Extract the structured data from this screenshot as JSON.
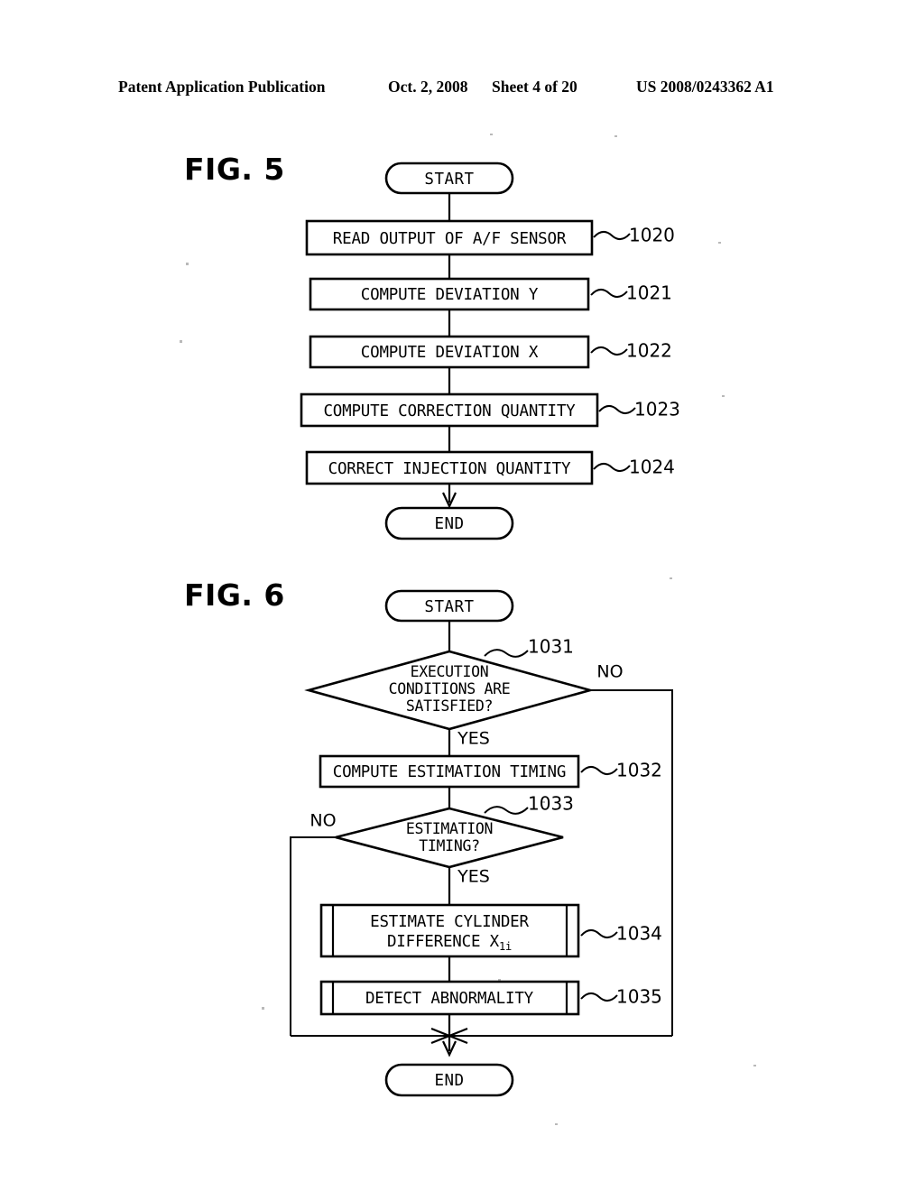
{
  "header": {
    "publication": "Patent Application Publication",
    "date": "Oct. 2, 2008",
    "sheet": "Sheet 4 of 20",
    "patent_number": "US 2008/0243362 A1"
  },
  "figures": [
    {
      "id": "fig5",
      "label": "FIG. 5",
      "terminators": {
        "start": "START",
        "end": "END"
      },
      "steps": [
        {
          "ref": "1020",
          "text": "READ OUTPUT OF A/F SENSOR"
        },
        {
          "ref": "1021",
          "text": "COMPUTE DEVIATION Y"
        },
        {
          "ref": "1022",
          "text": "COMPUTE DEVIATION X"
        },
        {
          "ref": "1023",
          "text": "COMPUTE CORRECTION QUANTITY"
        },
        {
          "ref": "1024",
          "text": "CORRECT INJECTION QUANTITY"
        }
      ]
    },
    {
      "id": "fig6",
      "label": "FIG. 6",
      "terminators": {
        "start": "START",
        "end": "END"
      },
      "decisions": [
        {
          "ref": "1031",
          "lines": [
            "EXECUTION",
            "CONDITIONS ARE",
            "SATISFIED?"
          ],
          "yes_label": "YES",
          "no_label": "NO"
        },
        {
          "ref": "1033",
          "lines": [
            "ESTIMATION",
            "TIMING?"
          ],
          "yes_label": "YES",
          "no_label": "NO"
        }
      ],
      "steps": [
        {
          "ref": "1032",
          "text": "COMPUTE ESTIMATION TIMING",
          "type": "process"
        },
        {
          "ref": "1034",
          "type": "predefined-process",
          "lines": [
            {
              "text": "ESTIMATE CYLINDER"
            },
            {
              "text": "DIFFERENCE X",
              "subscript": "1i"
            }
          ]
        },
        {
          "ref": "1035",
          "text": "DETECT ABNORMALITY",
          "type": "predefined-process"
        }
      ]
    }
  ],
  "colors": {
    "ink": "#000000",
    "paper": "#ffffff"
  }
}
